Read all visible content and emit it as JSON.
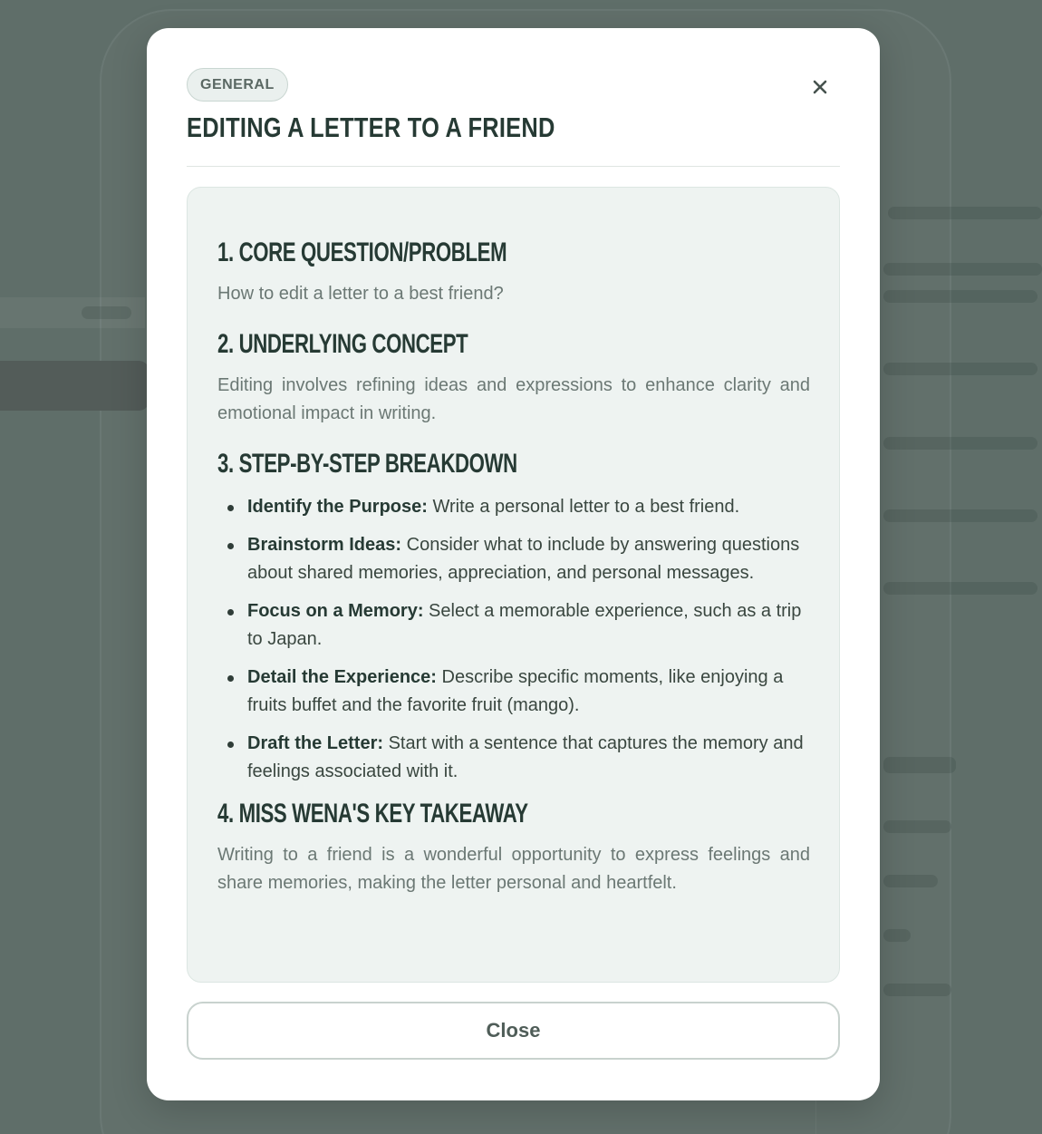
{
  "modal": {
    "category_tag": "GENERAL",
    "title": "EDITING A LETTER TO A FRIEND",
    "close_icon": "close-icon",
    "close_button_label": "Close"
  },
  "content": {
    "sections": [
      {
        "heading": "1. CORE QUESTION/PROBLEM",
        "text": "How to edit a letter to a best friend?"
      },
      {
        "heading": "2. UNDERLYING CONCEPT",
        "text": "Editing involves refining ideas and expressions to enhance clarity and emotional impact in writing."
      },
      {
        "heading": "3. STEP-BY-STEP BREAKDOWN",
        "steps": [
          {
            "title": "Identify the Purpose:",
            "text": "Write a personal letter to a best friend."
          },
          {
            "title": "Brainstorm Ideas:",
            "text": "Consider what to include by answering questions about shared memories, appreciation, and personal messages."
          },
          {
            "title": "Focus on a Memory:",
            "text": "Select a memorable experience, such as a trip to Japan."
          },
          {
            "title": "Detail the Experience:",
            "text": "Describe specific moments, like enjoying a fruits buffet and the favorite fruit (mango)."
          },
          {
            "title": "Draft the Letter:",
            "text": "Start with a sentence that captures the memory and feelings associated with it."
          }
        ]
      },
      {
        "heading": "4. MISS WENA'S KEY TAKEAWAY",
        "text": "Writing to a friend is a wonderful opportunity to express feelings and share memories, making the letter personal and heartfelt."
      }
    ]
  },
  "colors": {
    "backdrop": "#5f6e69",
    "modal_bg": "#ffffff",
    "content_bg": "#eef3f1",
    "heading": "#263a34",
    "body_text": "#6b7874"
  }
}
